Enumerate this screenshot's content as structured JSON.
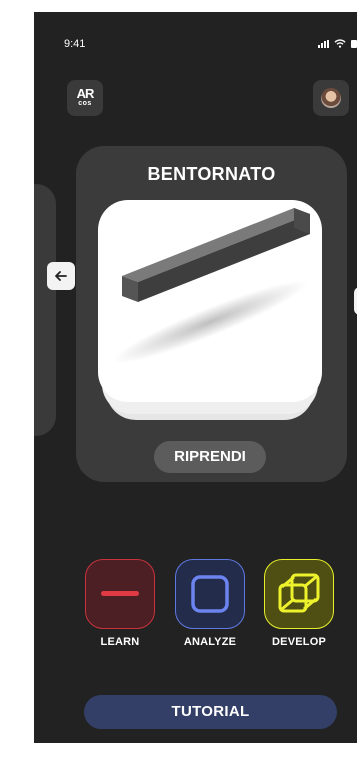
{
  "status_bar": {
    "time": "9:41",
    "icons": [
      "signal-icon",
      "wifi-icon",
      "battery-icon"
    ]
  },
  "header": {
    "logo_top": "AR",
    "logo_bottom": "cos",
    "avatar_icon": "user-avatar"
  },
  "carousel": {
    "title": "BENTORNATO",
    "resume_label": "RIPRENDI",
    "prev_icon": "arrow-left-icon",
    "next_icon": "arrow-right-icon",
    "preview_icon": "3d-bar-model"
  },
  "modes": [
    {
      "label": "LEARN",
      "icon": "dash-icon",
      "color": "#e23a45"
    },
    {
      "label": "ANALYZE",
      "icon": "square-icon",
      "color": "#6c84f0"
    },
    {
      "label": "DEVELOP",
      "icon": "cube-wireframe-icon",
      "color": "#eef22c"
    }
  ],
  "footer": {
    "tutorial_label": "TUTORIAL"
  },
  "colors": {
    "background": "#222222",
    "card": "#3b3b3b",
    "tutorial": "#333f67"
  }
}
